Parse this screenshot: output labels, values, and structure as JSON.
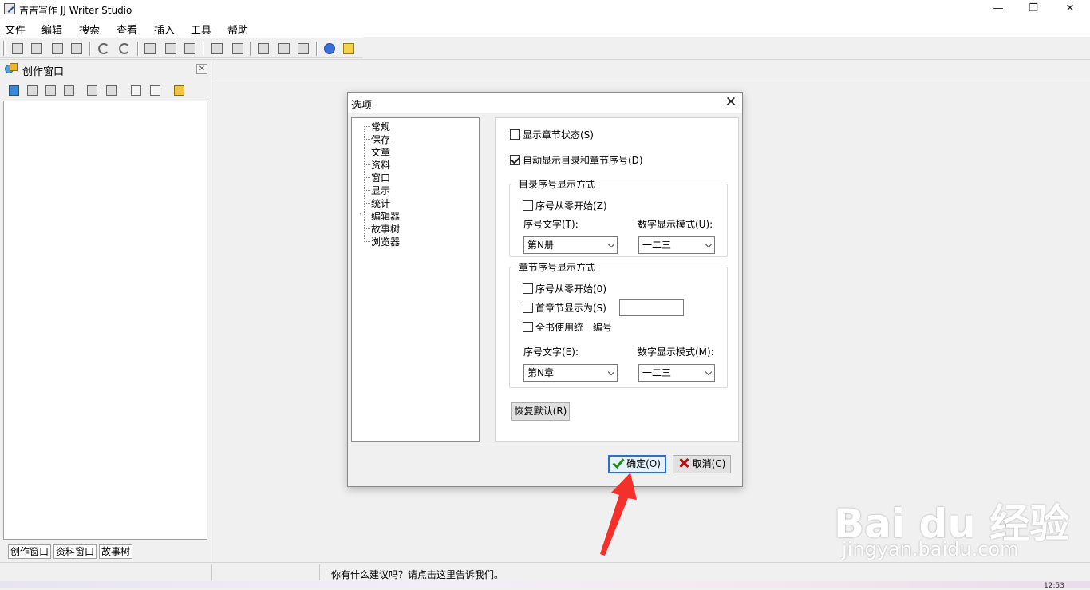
{
  "window": {
    "title": "吉吉写作 JJ Writer Studio",
    "controls": {
      "minimize": "—",
      "restore": "❐",
      "close": "✕"
    }
  },
  "menu": [
    "文件",
    "编辑",
    "搜索",
    "查看",
    "插入",
    "工具",
    "帮助"
  ],
  "toolbar_icons": [
    "save-icon",
    "save-all-icon",
    "print-icon",
    "print-preview-icon",
    "undo-icon",
    "redo-icon",
    "cut-icon",
    "copy-icon",
    "paste-icon",
    "indent-icon",
    "outdent-icon",
    "find-icon",
    "replace-icon",
    "find-next-icon",
    "help-icon",
    "tips-icon"
  ],
  "left_pane": {
    "title": "创作窗口",
    "close": "✕",
    "tabs": [
      "创作窗口",
      "资料窗口",
      "故事树"
    ]
  },
  "status": {
    "message": "你有什么建议吗？请点击这里告诉我们。",
    "clock": "12:53"
  },
  "dialog": {
    "title": "选项",
    "close": "✕",
    "tree": [
      "常规",
      "保存",
      "文章",
      "资料",
      "窗口",
      "显示",
      "统计",
      "编辑器",
      "故事树",
      "浏览器"
    ],
    "expander": "›",
    "show_chapter_status": {
      "label": "显示章节状态(S)",
      "checked": false
    },
    "auto_show_toc": {
      "label": "自动显示目录和章节序号(D)",
      "checked": true
    },
    "toc_group": {
      "title": "目录序号显示方式",
      "start_zero": {
        "label": "序号从零开始(Z)",
        "checked": false
      },
      "seq_text_label": "序号文字(T):",
      "num_mode_label": "数字显示模式(U):",
      "seq_text_value": "第N册",
      "num_mode_value": "一二三"
    },
    "chapter_group": {
      "title": "章节序号显示方式",
      "start_zero": {
        "label": "序号从零开始(0)",
        "checked": false
      },
      "first_chapter": {
        "label": "首章节显示为(S)",
        "checked": false
      },
      "first_chapter_value": "",
      "unified": {
        "label": "全书使用统一编号",
        "checked": false
      },
      "seq_text_label": "序号文字(E):",
      "num_mode_label": "数字显示模式(M):",
      "seq_text_value": "第N章",
      "num_mode_value": "一二三"
    },
    "restore_default": "恢复默认(R)",
    "ok": "确定(O)",
    "cancel": "取消(C)"
  },
  "watermark": {
    "logo": "Bai du 经验",
    "url": "jingyan.baidu.com"
  },
  "colors": {
    "accent": "#2d6fd1",
    "arrow": "#f4302a",
    "ok_check": "#1e8a1e",
    "cancel_x": "#b31212"
  }
}
